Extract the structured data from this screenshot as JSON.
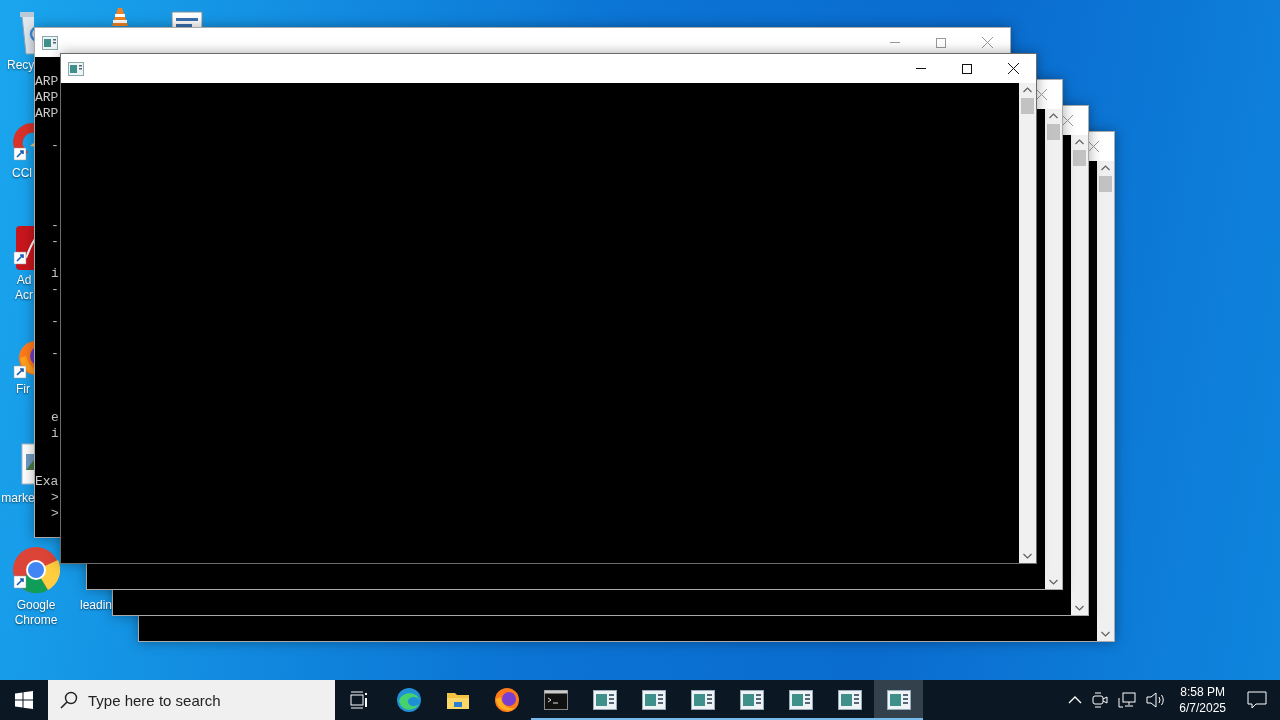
{
  "desktop_icons": [
    {
      "kind": "recycle-bin",
      "label_lines": [
        "Recy"
      ]
    },
    {
      "kind": "cone"
    },
    {
      "kind": "sheet"
    },
    {
      "kind": "cleaner",
      "label_lines": [
        "CCl"
      ]
    },
    {
      "kind": "pdf",
      "label_lines": [
        "Ad",
        "Acr"
      ]
    },
    {
      "kind": "fox",
      "label_lines": [
        "Fir"
      ]
    },
    {
      "kind": "image",
      "label_lines": [
        "marke"
      ]
    },
    {
      "kind": "chrome",
      "label_lines": [
        "Google",
        "Chrome"
      ]
    },
    {
      "kind": "hidden",
      "label_lines": [
        "leadin"
      ]
    }
  ],
  "windows": [
    {
      "active": false,
      "console_lines": [
        {
          "text": "ARP",
          "indent": false
        },
        {
          "text": "ARP",
          "indent": false
        },
        {
          "text": "ARP",
          "indent": false
        },
        {
          "text": "-",
          "indent": true
        },
        {
          "text": "-",
          "indent": true
        },
        {
          "text": "-",
          "indent": true
        },
        {
          "text": "i",
          "indent": true
        },
        {
          "text": "-",
          "indent": true
        },
        {
          "text": "-",
          "indent": true
        },
        {
          "text": "-",
          "indent": true
        },
        {
          "text": "e",
          "indent": true
        },
        {
          "text": "i",
          "indent": true
        },
        {
          "text": "Exa",
          "indent": false
        },
        {
          "text": ">",
          "indent": true
        },
        {
          "text": ">",
          "indent": true
        }
      ]
    },
    {
      "active": false
    },
    {
      "active": false
    },
    {
      "active": false
    },
    {
      "active": true
    }
  ],
  "taskbar": {
    "search": {
      "placeholder": "Type here to search"
    },
    "apps": [
      {
        "kind": "browser",
        "running": false,
        "active": false
      },
      {
        "kind": "folder",
        "running": false,
        "active": false
      },
      {
        "kind": "fox",
        "running": false,
        "active": false
      },
      {
        "kind": "terminal",
        "running": true,
        "active": false
      },
      {
        "kind": "window",
        "running": true,
        "active": false
      },
      {
        "kind": "window",
        "running": true,
        "active": false
      },
      {
        "kind": "window",
        "running": true,
        "active": false
      },
      {
        "kind": "window",
        "running": true,
        "active": false
      },
      {
        "kind": "window",
        "running": true,
        "active": false
      },
      {
        "kind": "window",
        "running": true,
        "active": false
      },
      {
        "kind": "window",
        "running": true,
        "active": true
      }
    ],
    "clock": {
      "time": "8:58 PM",
      "date": "6/7/2025"
    }
  }
}
